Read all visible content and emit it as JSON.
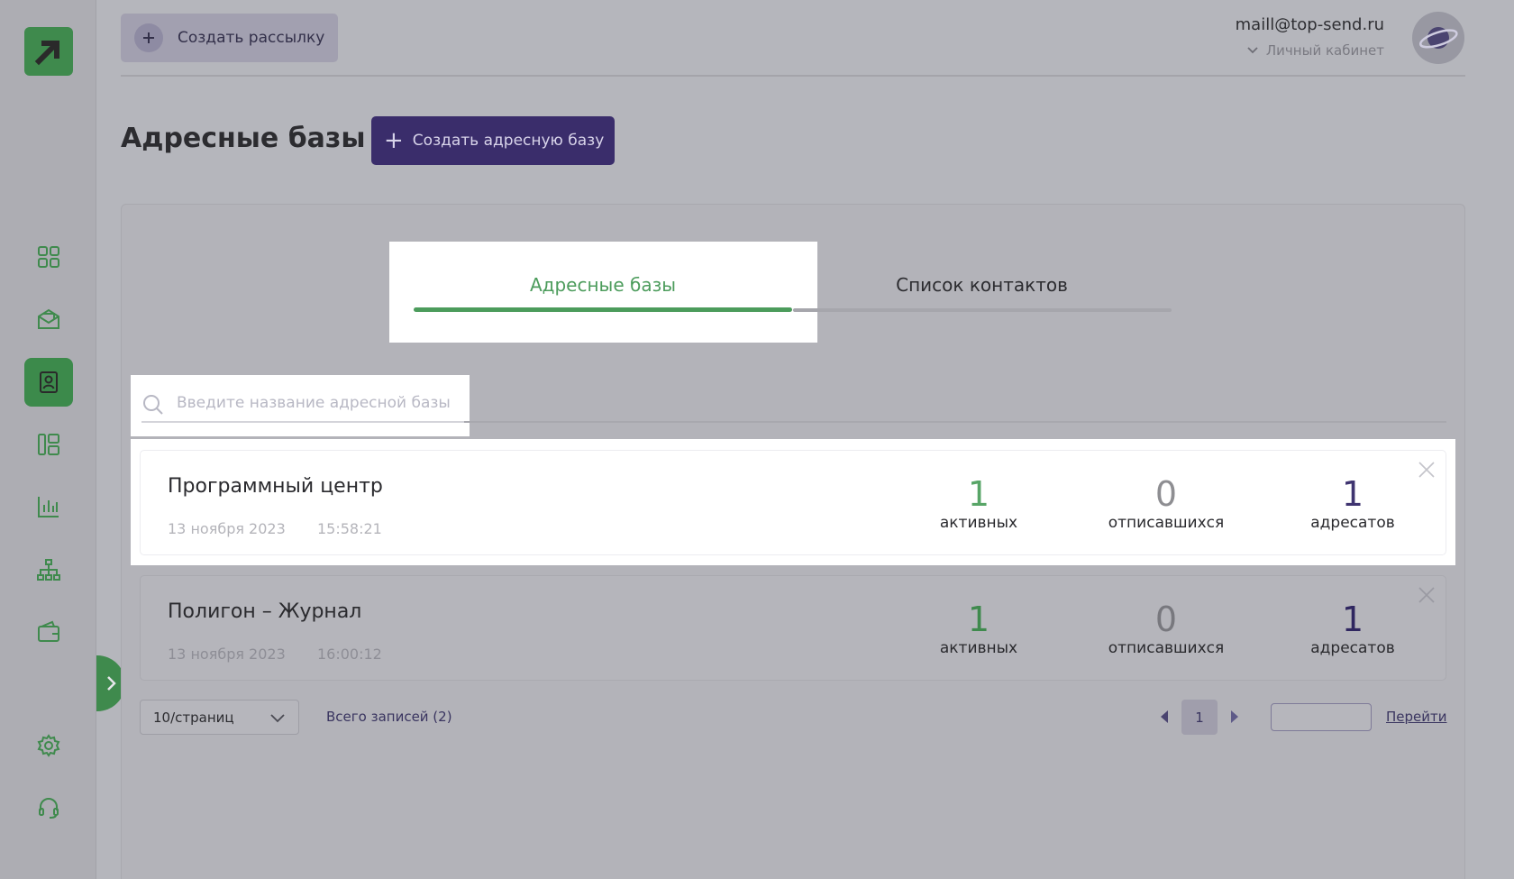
{
  "header": {
    "create_mailing_label": "Создать рассылку",
    "user_email": "maill@top-send.ru",
    "cabinet_label": "Личный кабинет"
  },
  "page": {
    "title": "Адресные базы",
    "create_db_label": "Создать адресную базу"
  },
  "sidebar": {
    "items": [
      {
        "icon": "dashboard-icon"
      },
      {
        "icon": "mail-icon"
      },
      {
        "icon": "contacts-icon",
        "active": true
      },
      {
        "icon": "templates-icon"
      },
      {
        "icon": "stats-icon"
      },
      {
        "icon": "hierarchy-icon"
      },
      {
        "icon": "wallet-icon"
      },
      {
        "icon": "settings-icon"
      },
      {
        "icon": "support-icon"
      }
    ]
  },
  "tabs": [
    {
      "label": "Адресные базы",
      "active": true
    },
    {
      "label": "Список контактов",
      "active": false
    }
  ],
  "search": {
    "placeholder": "Введите название адресной базы"
  },
  "databases": [
    {
      "name": "Программный центр",
      "date": "13 ноября 2023",
      "time": "15:58:21",
      "active": "1",
      "active_label": "активных",
      "unsubscribed": "0",
      "unsubscribed_label": "отписавшихся",
      "total": "1",
      "total_label": "адресатов"
    },
    {
      "name": "Полигон – Журнал",
      "date": "13 ноября 2023",
      "time": "16:00:12",
      "active": "1",
      "active_label": "активных",
      "unsubscribed": "0",
      "unsubscribed_label": "отписавшихся",
      "total": "1",
      "total_label": "адресатов"
    }
  ],
  "pagination": {
    "per_page": "10/страниц",
    "total_records": "Всего записей (2)",
    "current_page": "1",
    "goto_label": "Перейти"
  },
  "colors": {
    "brand_green": "#3f8a4d",
    "brand_purple": "#3a2d6b",
    "accent_green_text": "#4c9c5c"
  }
}
